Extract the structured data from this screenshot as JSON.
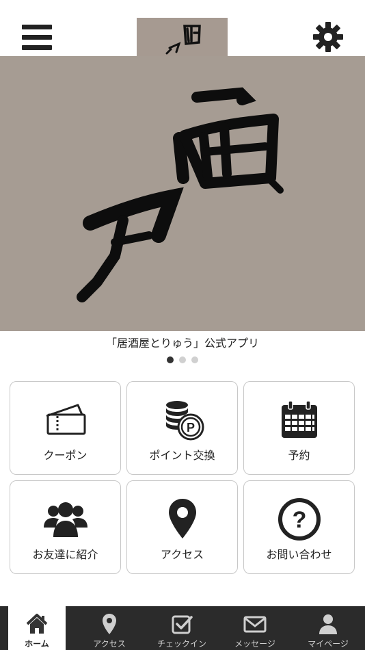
{
  "hero": {
    "caption": "「居酒屋とりゅう」公式アプリ"
  },
  "carousel": {
    "count": 3,
    "active": 0
  },
  "menu": [
    {
      "label": "クーポン",
      "icon": "coupon-icon"
    },
    {
      "label": "ポイント交換",
      "icon": "point-exchange-icon"
    },
    {
      "label": "予約",
      "icon": "calendar-icon"
    },
    {
      "label": "お友達に紹介",
      "icon": "friends-icon"
    },
    {
      "label": "アクセス",
      "icon": "map-pin-icon"
    },
    {
      "label": "お問い合わせ",
      "icon": "question-icon"
    }
  ],
  "tabs": [
    {
      "label": "ホーム",
      "icon": "home-icon",
      "active": true
    },
    {
      "label": "アクセス",
      "icon": "map-pin-icon",
      "active": false
    },
    {
      "label": "チェックイン",
      "icon": "checkin-icon",
      "active": false
    },
    {
      "label": "メッセージ",
      "icon": "message-icon",
      "active": false
    },
    {
      "label": "マイページ",
      "icon": "user-icon",
      "active": false
    }
  ],
  "colors": {
    "brand_bg": "#a69c93",
    "tabbar": "#2b2b2b",
    "dot_active": "#333333",
    "dot_inactive": "#d0d0d0"
  }
}
